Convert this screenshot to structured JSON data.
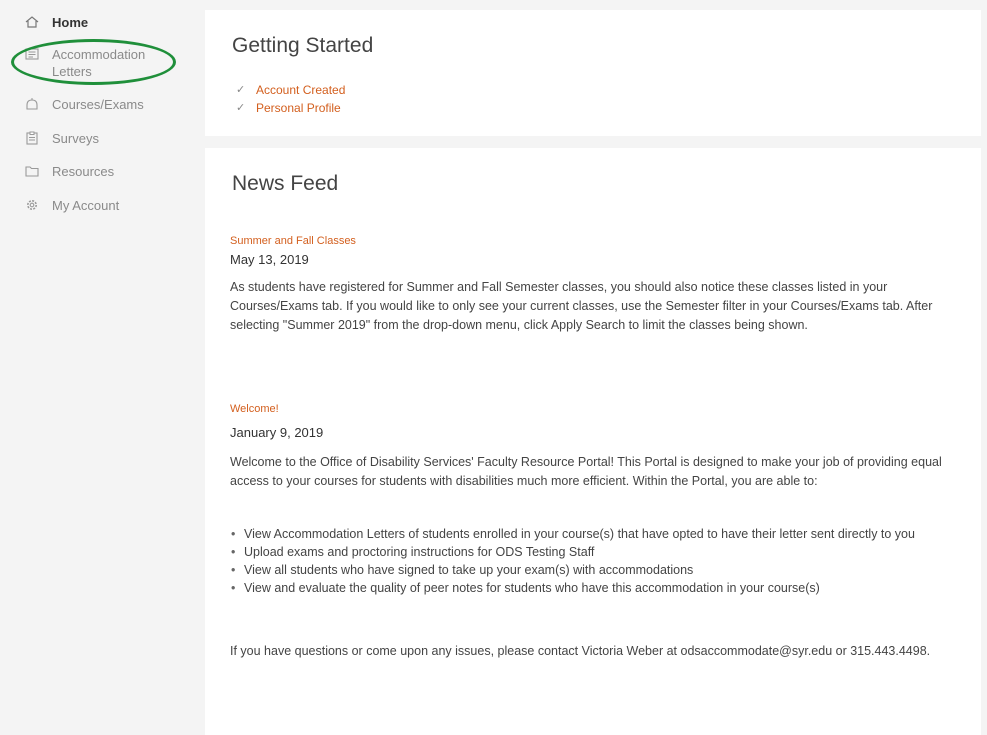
{
  "sidebar": {
    "items": [
      {
        "label": "Home",
        "icon": "home-icon",
        "active": true
      },
      {
        "label": "Accommodation\nLetters",
        "icon": "letter-icon",
        "active": false
      },
      {
        "label": "Courses/Exams",
        "icon": "courses-icon",
        "active": false
      },
      {
        "label": "Surveys",
        "icon": "survey-icon",
        "active": false
      },
      {
        "label": "Resources",
        "icon": "folder-icon",
        "active": false
      },
      {
        "label": "My Account",
        "icon": "gear-icon",
        "active": false
      }
    ]
  },
  "getting_started": {
    "title": "Getting Started",
    "items": [
      "Account Created",
      "Personal Profile"
    ]
  },
  "news_feed": {
    "title": "News Feed",
    "posts": [
      {
        "title": "Summer and Fall Classes",
        "date": "May 13, 2019",
        "body": "As students have registered for Summer and Fall Semester classes, you should also notice these classes listed in your Courses/Exams tab. If you would like to only see your current classes, use the Semester filter in your Courses/Exams tab. After selecting \"Summer 2019\" from the drop-down menu, click Apply Search to limit the classes being shown."
      },
      {
        "title": "Welcome!",
        "date": "January 9, 2019",
        "body": "Welcome to the Office of Disability Services' Faculty Resource Portal! This Portal is designed to make your job of providing equal access to your courses for students with disabilities much more efficient. Within the Portal, you are able to:",
        "bullets": [
          "View Accommodation Letters of students enrolled in your course(s) that have opted to have their letter sent directly to you",
          "Upload exams and proctoring instructions for ODS Testing Staff",
          "View all students who have signed to take up your exam(s) with accommodations",
          "View and evaluate the quality of peer notes for students who have this accommodation in your course(s)"
        ],
        "footer": "If you have questions or come upon any issues, please contact Victoria Weber at odsaccommodate@syr.edu or 315.443.4498."
      }
    ]
  },
  "colors": {
    "accent": "#d35f1e",
    "highlight_ring": "#1f8f3a"
  }
}
